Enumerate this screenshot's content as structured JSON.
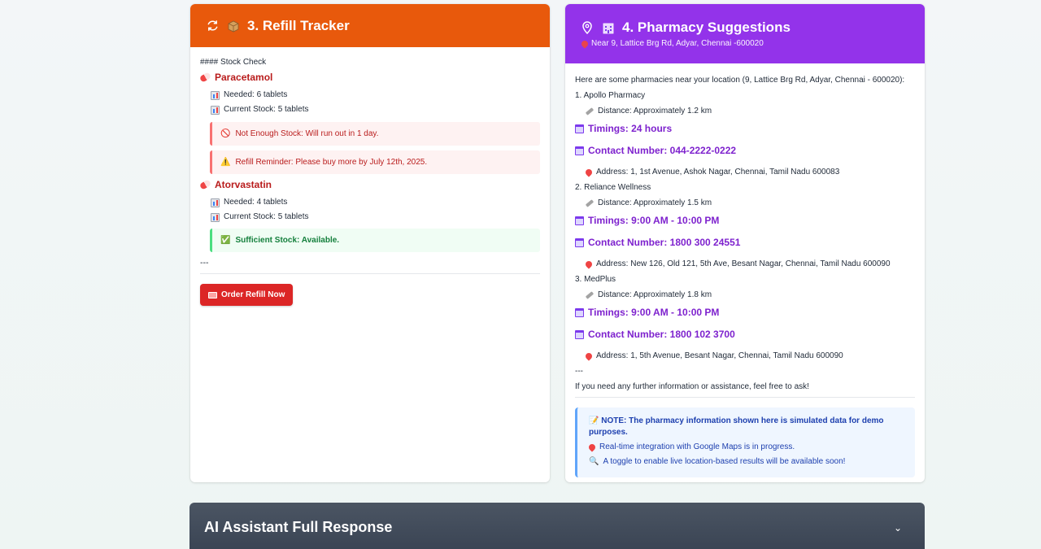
{
  "refill": {
    "title": "3. Refill Tracker",
    "heading": "#### Stock Check",
    "meds": [
      {
        "name": "Paracetamol",
        "needed": "Needed: 6 tablets",
        "stock": "Current Stock: 5 tablets",
        "alerts": [
          {
            "type": "danger",
            "icon": "🚫",
            "text": "Not Enough Stock: Will run out in 1 day."
          },
          {
            "type": "danger",
            "icon": "⚠️",
            "text": "Refill Reminder: Please buy more by July 12th, 2025."
          }
        ]
      },
      {
        "name": "Atorvastatin",
        "needed": "Needed: 4 tablets",
        "stock": "Current Stock: 5 tablets",
        "alerts": [
          {
            "type": "success",
            "icon": "✅",
            "text": "Sufficient Stock: Available."
          }
        ]
      }
    ],
    "separator": "---",
    "button_label": "Order Refill Now"
  },
  "pharmacy": {
    "title": "4. Pharmacy Suggestions",
    "location": "Near 9, Lattice Brg Rd, Adyar, Chennai -600020",
    "intro": "Here are some pharmacies near your location (9, Lattice Brg Rd, Adyar, Chennai - 600020):",
    "items": [
      {
        "name": "1. Apollo Pharmacy",
        "distance": "Distance: Approximately 1.2 km",
        "timings": "Timings: 24 hours",
        "contact": "Contact Number: 044-2222-0222",
        "address": "Address: 1, 1st Avenue, Ashok Nagar, Chennai, Tamil Nadu 600083"
      },
      {
        "name": "2. Reliance Wellness",
        "distance": "Distance: Approximately 1.5 km",
        "timings": "Timings: 9:00 AM - 10:00 PM",
        "contact": "Contact Number: 1800 300 24551",
        "address": "Address: New 126, Old 121, 5th Ave, Besant Nagar, Chennai, Tamil Nadu 600090"
      },
      {
        "name": "3. MedPlus",
        "distance": "Distance: Approximately 1.8 km",
        "timings": "Timings: 9:00 AM - 10:00 PM",
        "contact": "Contact Number: 1800 102 3700",
        "address": "Address: 1, 5th Avenue, Besant Nagar, Chennai, Tamil Nadu 600090"
      }
    ],
    "separator": "---",
    "outro": "If you need any further information or assistance, feel free to ask!",
    "note": {
      "line1": "NOTE: The pharmacy information shown here is simulated data for demo purposes.",
      "line2": "Real-time integration with Google Maps is in progress.",
      "line3": "A toggle to enable live location-based results will be available soon!"
    }
  },
  "assistant_panel": {
    "title": "AI Assistant Full Response",
    "chevron": "⌄"
  },
  "colors": {
    "refill_header": "#e8590c",
    "pharmacy_header": "#9333ea",
    "danger": "#b91c1c",
    "success": "#15803d",
    "order_button": "#dc2626"
  }
}
